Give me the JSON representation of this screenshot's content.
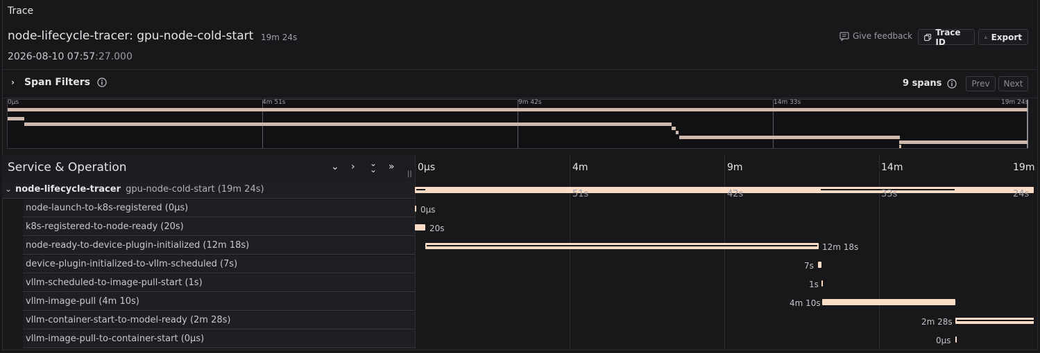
{
  "panel": {
    "title": "Trace"
  },
  "trace": {
    "name": "node-lifecycle-tracer: gpu-node-cold-start",
    "duration": "19m 24s",
    "date": "2026-08-10 07:57",
    "date_seconds": ":27.000"
  },
  "actions": {
    "feedback": "Give feedback",
    "trace_id": "Trace ID",
    "export": "Export"
  },
  "filters": {
    "label": "Span Filters",
    "span_count": "9 spans",
    "prev": "Prev",
    "next": "Next"
  },
  "minimap": {
    "ticks": [
      "0µs",
      "4m 51s",
      "9m 42s",
      "14m 33s",
      "19m 24s"
    ]
  },
  "timeline": {
    "header": "Service & Operation",
    "ticks": [
      {
        "top": "0µs",
        "bottom": ""
      },
      {
        "top": "4m",
        "bottom": "51s"
      },
      {
        "top": "9m",
        "bottom": "42s"
      },
      {
        "top": "14m",
        "bottom": "33s"
      },
      {
        "top": "19m",
        "bottom": "24s"
      }
    ]
  },
  "root_span": {
    "service": "node-lifecycle-tracer",
    "operation": "gpu-node-cold-start (19m 24s)"
  },
  "spans": [
    {
      "name": "node-launch-to-k8s-registered (0µs)",
      "label": "0µs"
    },
    {
      "name": "k8s-registered-to-node-ready (20s)",
      "label": "20s"
    },
    {
      "name": "node-ready-to-device-plugin-initialized (12m 18s)",
      "label": "12m 18s"
    },
    {
      "name": "device-plugin-initialized-to-vllm-scheduled (7s)",
      "label": "7s"
    },
    {
      "name": "vllm-scheduled-to-image-pull-start (1s)",
      "label": "1s"
    },
    {
      "name": "vllm-image-pull (4m 10s)",
      "label": "4m 10s"
    },
    {
      "name": "vllm-container-start-to-model-ready (2m 28s)",
      "label": "2m 28s"
    },
    {
      "name": "vllm-image-pull-to-container-start (0µs)",
      "label": "0µs"
    }
  ],
  "colors": {
    "bar": "#fadbc6",
    "minimap_bar": "#cfb9ad",
    "background": "#18181b"
  },
  "icons": [
    "feedback-icon",
    "copy-icon",
    "upload-icon",
    "chevron-right-icon",
    "info-icon",
    "chevron-down-icon",
    "double-chevron-down-icon",
    "double-chevron-right-icon",
    "resize-handle-icon"
  ]
}
